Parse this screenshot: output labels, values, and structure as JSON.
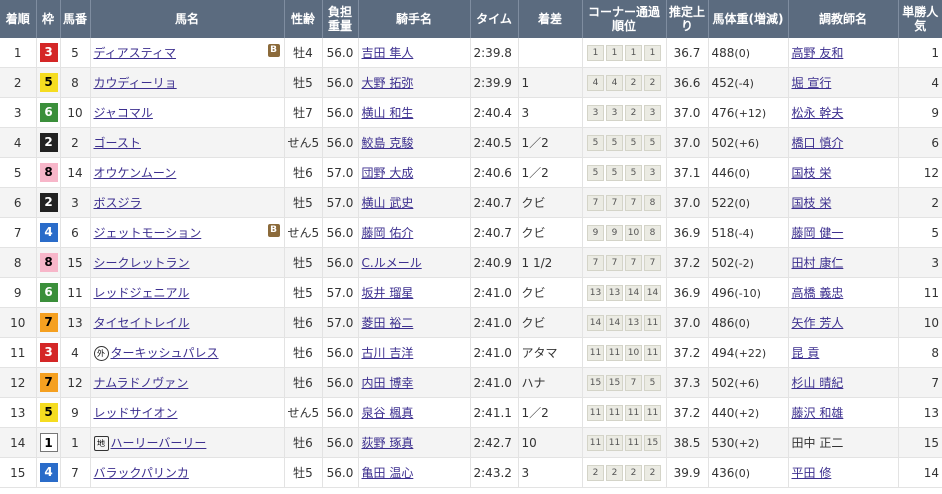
{
  "headers": {
    "rank": "着順",
    "waku": "枠",
    "num": "馬番",
    "horse": "馬名",
    "sexage": "性齢",
    "weight": "負担重量",
    "jockey": "騎手名",
    "time": "タイム",
    "margin": "着差",
    "corner": "コーナー通過順位",
    "last3f": "推定上り",
    "body": "馬体重(増減)",
    "trainer": "調教師名",
    "pop": "単勝人気"
  },
  "rows": [
    {
      "rank": "1",
      "waku": "3",
      "num": "5",
      "mark": "",
      "horse": "ディアスティマ",
      "badge": "B",
      "sexage": "牡4",
      "weight": "56.0",
      "jockey": "吉田 隼人",
      "time": "2:39.8",
      "margin": "",
      "corner": [
        "1",
        "1",
        "1",
        "1"
      ],
      "last3f": "36.7",
      "bw": "488",
      "diff": "(0)",
      "trainer": "高野 友和",
      "trainer_link": true,
      "pop": "1"
    },
    {
      "rank": "2",
      "waku": "5",
      "num": "8",
      "mark": "",
      "horse": "カウディーリョ",
      "badge": "",
      "sexage": "牡5",
      "weight": "56.0",
      "jockey": "大野 拓弥",
      "time": "2:39.9",
      "margin": "1",
      "corner": [
        "4",
        "4",
        "2",
        "2"
      ],
      "last3f": "36.6",
      "bw": "452",
      "diff": "(-4)",
      "trainer": "堀 宣行",
      "trainer_link": true,
      "pop": "4"
    },
    {
      "rank": "3",
      "waku": "6",
      "num": "10",
      "mark": "",
      "horse": "ジャコマル",
      "badge": "",
      "sexage": "牡7",
      "weight": "56.0",
      "jockey": "横山 和生",
      "time": "2:40.4",
      "margin": "3",
      "corner": [
        "3",
        "3",
        "2",
        "3"
      ],
      "last3f": "37.0",
      "bw": "476",
      "diff": "(+12)",
      "trainer": "松永 幹夫",
      "trainer_link": true,
      "pop": "9"
    },
    {
      "rank": "4",
      "waku": "2",
      "num": "2",
      "mark": "",
      "horse": "ゴースト",
      "badge": "",
      "sexage": "せん5",
      "weight": "56.0",
      "jockey": "鮫島 克駿",
      "time": "2:40.5",
      "margin": "1／2",
      "corner": [
        "5",
        "5",
        "5",
        "5"
      ],
      "last3f": "37.0",
      "bw": "502",
      "diff": "(+6)",
      "trainer": "橋口 慎介",
      "trainer_link": true,
      "pop": "6"
    },
    {
      "rank": "5",
      "waku": "8",
      "num": "14",
      "mark": "",
      "horse": "オウケンムーン",
      "badge": "",
      "sexage": "牡6",
      "weight": "57.0",
      "jockey": "団野 大成",
      "time": "2:40.6",
      "margin": "1／2",
      "corner": [
        "5",
        "5",
        "5",
        "3"
      ],
      "last3f": "37.1",
      "bw": "446",
      "diff": "(0)",
      "trainer": "国枝 栄",
      "trainer_link": true,
      "pop": "12"
    },
    {
      "rank": "6",
      "waku": "2",
      "num": "3",
      "mark": "",
      "horse": "ボスジラ",
      "badge": "",
      "sexage": "牡5",
      "weight": "57.0",
      "jockey": "横山 武史",
      "time": "2:40.7",
      "margin": "クビ",
      "corner": [
        "7",
        "7",
        "7",
        "8"
      ],
      "last3f": "37.0",
      "bw": "522",
      "diff": "(0)",
      "trainer": "国枝 栄",
      "trainer_link": true,
      "pop": "2"
    },
    {
      "rank": "7",
      "waku": "4",
      "num": "6",
      "mark": "",
      "horse": "ジェットモーション",
      "badge": "B",
      "sexage": "せん5",
      "weight": "56.0",
      "jockey": "藤岡 佑介",
      "time": "2:40.7",
      "margin": "クビ",
      "corner": [
        "9",
        "9",
        "10",
        "8"
      ],
      "last3f": "36.9",
      "bw": "518",
      "diff": "(-4)",
      "trainer": "藤岡 健一",
      "trainer_link": true,
      "pop": "5"
    },
    {
      "rank": "8",
      "waku": "8",
      "num": "15",
      "mark": "",
      "horse": "シークレットラン",
      "badge": "",
      "sexage": "牡5",
      "weight": "56.0",
      "jockey": "C.ルメール",
      "time": "2:40.9",
      "margin": "1 1/2",
      "corner": [
        "7",
        "7",
        "7",
        "7"
      ],
      "last3f": "37.2",
      "bw": "502",
      "diff": "(-2)",
      "trainer": "田村 康仁",
      "trainer_link": true,
      "pop": "3"
    },
    {
      "rank": "9",
      "waku": "6",
      "num": "11",
      "mark": "",
      "horse": "レッドジェニアル",
      "badge": "",
      "sexage": "牡5",
      "weight": "57.0",
      "jockey": "坂井 瑠星",
      "time": "2:41.0",
      "margin": "クビ",
      "corner": [
        "13",
        "13",
        "14",
        "14"
      ],
      "last3f": "36.9",
      "bw": "496",
      "diff": "(-10)",
      "trainer": "高橋 義忠",
      "trainer_link": true,
      "pop": "11"
    },
    {
      "rank": "10",
      "waku": "7",
      "num": "13",
      "mark": "",
      "horse": "タイセイトレイル",
      "badge": "",
      "sexage": "牡6",
      "weight": "57.0",
      "jockey": "菱田 裕二",
      "time": "2:41.0",
      "margin": "クビ",
      "corner": [
        "14",
        "14",
        "13",
        "11"
      ],
      "last3f": "37.0",
      "bw": "486",
      "diff": "(0)",
      "trainer": "矢作 芳人",
      "trainer_link": true,
      "pop": "10"
    },
    {
      "rank": "11",
      "waku": "3",
      "num": "4",
      "mark": "外",
      "horse": "ターキッシュパレス",
      "badge": "",
      "sexage": "牡6",
      "weight": "56.0",
      "jockey": "古川 吉洋",
      "time": "2:41.0",
      "margin": "アタマ",
      "corner": [
        "11",
        "11",
        "10",
        "11"
      ],
      "last3f": "37.2",
      "bw": "494",
      "diff": "(+22)",
      "trainer": "昆 貢",
      "trainer_link": true,
      "pop": "8"
    },
    {
      "rank": "12",
      "waku": "7",
      "num": "12",
      "mark": "",
      "horse": "ナムラドノヴァン",
      "badge": "",
      "sexage": "牡6",
      "weight": "56.0",
      "jockey": "内田 博幸",
      "time": "2:41.0",
      "margin": "ハナ",
      "corner": [
        "15",
        "15",
        "7",
        "5"
      ],
      "last3f": "37.3",
      "bw": "502",
      "diff": "(+6)",
      "trainer": "杉山 晴紀",
      "trainer_link": true,
      "pop": "7"
    },
    {
      "rank": "13",
      "waku": "5",
      "num": "9",
      "mark": "",
      "horse": "レッドサイオン",
      "badge": "",
      "sexage": "せん5",
      "weight": "56.0",
      "jockey": "泉谷 楓真",
      "time": "2:41.1",
      "margin": "1／2",
      "corner": [
        "11",
        "11",
        "11",
        "11"
      ],
      "last3f": "37.2",
      "bw": "440",
      "diff": "(+2)",
      "trainer": "藤沢 和雄",
      "trainer_link": true,
      "pop": "13"
    },
    {
      "rank": "14",
      "waku": "1",
      "num": "1",
      "mark": "地",
      "horse": "ハーリーバーリー",
      "badge": "",
      "sexage": "牡6",
      "weight": "56.0",
      "jockey": "荻野 琢真",
      "time": "2:42.7",
      "margin": "10",
      "corner": [
        "11",
        "11",
        "11",
        "15"
      ],
      "last3f": "38.5",
      "bw": "530",
      "diff": "(+2)",
      "trainer": "田中 正二",
      "trainer_link": false,
      "pop": "15"
    },
    {
      "rank": "15",
      "waku": "4",
      "num": "7",
      "mark": "",
      "horse": "バラックパリンカ",
      "badge": "",
      "sexage": "牡5",
      "weight": "56.0",
      "jockey": "亀田 温心",
      "time": "2:43.2",
      "margin": "3",
      "corner": [
        "2",
        "2",
        "2",
        "2"
      ],
      "last3f": "39.9",
      "bw": "436",
      "diff": "(0)",
      "trainer": "平田 修",
      "trainer_link": true,
      "pop": "14"
    }
  ]
}
